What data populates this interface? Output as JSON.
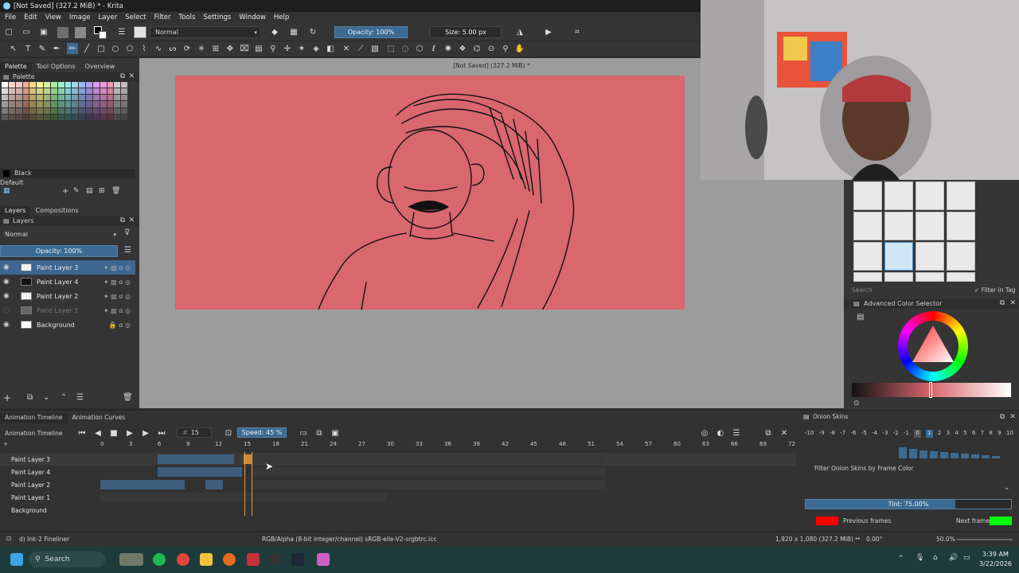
{
  "window": {
    "title": "[Not Saved]  (327.2 MiB) * - Krita"
  },
  "menu": [
    "File",
    "Edit",
    "View",
    "Image",
    "Layer",
    "Select",
    "Filter",
    "Tools",
    "Settings",
    "Window",
    "Help"
  ],
  "toolbar": {
    "blend_mode": "Normal",
    "opacity": "Opacity: 100%",
    "size": "Size: 5.00 px"
  },
  "left_dock": {
    "tabs": [
      "Palette",
      "Tool Options",
      "Overview"
    ],
    "palette_name": "Palette",
    "current_color_name": "Black",
    "palette_set": "Default",
    "layers_tabs": [
      "Layers",
      "Compositions"
    ],
    "layers_blend": "Normal",
    "layers_opacity": "Opacity:  100%",
    "layers": [
      {
        "name": "Paint Layer 3",
        "selected": true
      },
      {
        "name": "Paint Layer 4",
        "selected": false
      },
      {
        "name": "Paint Layer 2",
        "selected": false
      },
      {
        "name": "Paint Layer 1",
        "selected": false
      },
      {
        "name": "Background",
        "selected": false
      }
    ]
  },
  "canvas": {
    "title": "[Not Saved]  (327.2 MiB) *",
    "background": "#d9676e"
  },
  "right_dock": {
    "search_placeholder": "Search",
    "filter_in_tag": "Filter in Tag",
    "color_selector_title": "Advanced Color Selector"
  },
  "animation": {
    "tabs": [
      "Animation Timeline",
      "Animation Curves"
    ],
    "label": "Animation Timeline",
    "current_frame": "15",
    "speed": "Speed: 45 %",
    "ruler": [
      "0",
      "3",
      "6",
      "9",
      "12",
      "15",
      "18",
      "21",
      "24",
      "27",
      "30",
      "33",
      "36",
      "39",
      "42",
      "45",
      "48",
      "51",
      "54",
      "57",
      "60",
      "63",
      "66",
      "69",
      "72"
    ],
    "layers": [
      "Paint Layer 3",
      "Paint Layer 4",
      "Paint Layer 2",
      "Paint Layer 1",
      "Background"
    ]
  },
  "onion": {
    "title": "Onion Skins",
    "numbers": [
      "-10",
      "-9",
      "-8",
      "-7",
      "-6",
      "-5",
      "-4",
      "-3",
      "-2",
      "-1",
      "0",
      "1",
      "2",
      "3",
      "4",
      "5",
      "6",
      "7",
      "8",
      "9",
      "10"
    ],
    "filter_label": "Filter Onion Skins by Frame Color",
    "tint": "Tint: 75.00%",
    "previous_frames": "Previous frames",
    "next_frames": "Next frames",
    "previous_color": "#ff0000",
    "next_color": "#00ff00"
  },
  "statusbar": {
    "brush": "d) Ink-2 Fineliner",
    "color_info": "RGB/Alpha (8-bit integer/channel)  sRGB-elle-V2-srgbtrc.icc",
    "dimensions": "1,920 x 1,080 (327.2 MiB)",
    "rotation": "0.00°",
    "zoom": "50.0%"
  },
  "taskbar": {
    "search": "Search",
    "time": "3:39 AM",
    "date": "3/22/2026"
  }
}
